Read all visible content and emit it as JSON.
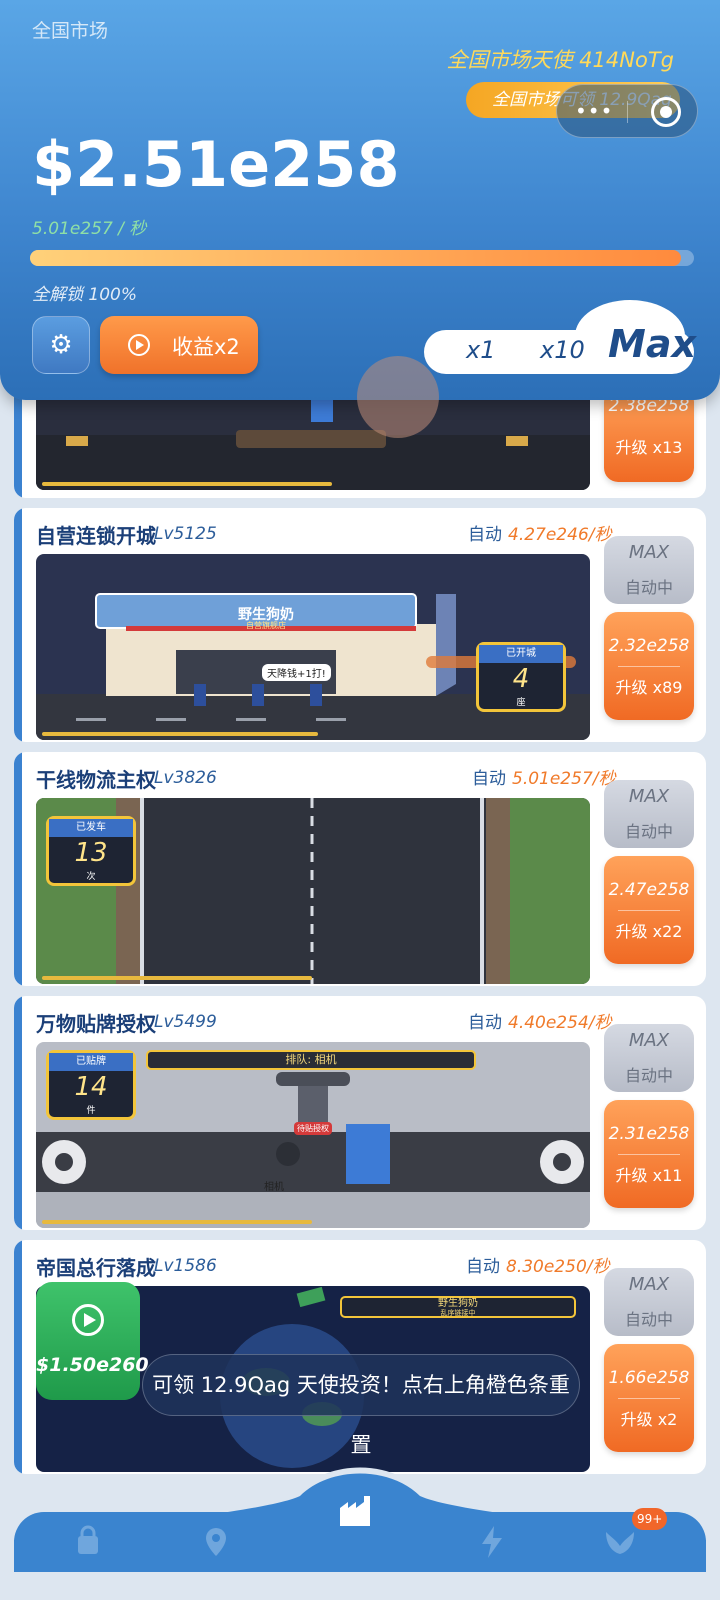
{
  "header": {
    "market_title": "全国市场",
    "angel_text": "全国市场天使 414NoTg",
    "angel_claim": "全国市场可领 12.9Qag",
    "money": "$2.51e258",
    "rate": "5.01e257 / 秒",
    "progress_pct": 98,
    "unlock_text": "全解锁 100%",
    "boost_label": "收益x2",
    "multipliers": [
      "x1",
      "x10",
      "Max"
    ],
    "selected_multiplier": "Max"
  },
  "cards": [
    {
      "name": "",
      "level": "",
      "auto_label": "",
      "rate": "",
      "max_label": "",
      "max_sub": "",
      "upgrade_cost": "2.38e258",
      "upgrade_label": "升级 x13"
    },
    {
      "name": "自营连锁开城",
      "level": "Lv5125",
      "auto_label": "自动",
      "rate": "4.27e246/秒",
      "max_label": "MAX",
      "max_sub": "自动中",
      "upgrade_cost": "2.32e258",
      "upgrade_label": "升级 x89",
      "sign_header": "已开城",
      "sign_value": "4",
      "sign_unit": "座",
      "store_sign": "野生狗奶",
      "store_sub": "自营旗舰店",
      "speech": "天降钱+1打!"
    },
    {
      "name": "干线物流主权",
      "level": "Lv3826",
      "auto_label": "自动",
      "rate": "5.01e257/秒",
      "max_label": "MAX",
      "max_sub": "自动中",
      "upgrade_cost": "2.47e258",
      "upgrade_label": "升级 x22",
      "sign_header": "已发车",
      "sign_value": "13",
      "sign_unit": "次"
    },
    {
      "name": "万物贴牌授权",
      "level": "Lv5499",
      "auto_label": "自动",
      "rate": "4.40e254/秒",
      "max_label": "MAX",
      "max_sub": "自动中",
      "upgrade_cost": "2.31e258",
      "upgrade_label": "升级 x11",
      "sign_header": "已贴牌",
      "sign_value": "14",
      "sign_unit": "件",
      "queue_text": "排队: 相机",
      "item_label": "相机",
      "tag_label": "待贴授权"
    },
    {
      "name": "帝国总行落成",
      "level": "Lv1586",
      "auto_label": "自动",
      "rate": "8.30e250/秒",
      "max_label": "MAX",
      "max_sub": "自动中",
      "upgrade_cost": "1.66e258",
      "upgrade_label": "升级 x2",
      "banner": "野生狗奶",
      "banner_sub": "乱序链接中"
    }
  ],
  "video_reward": "$1.50e260",
  "toast": "可领 12.9Qag 天使投资！点右上角橙色条重置",
  "nav": {
    "items": [
      "bag-icon",
      "map-pin-icon",
      "factory-icon",
      "lightning-icon",
      "wings-icon"
    ],
    "active": "factory-icon",
    "badge": "99+"
  },
  "colors": {
    "accent": "#3b82d0",
    "orange": "#f07a2a",
    "gold": "#ffd95a",
    "green": "#1f9a4a"
  }
}
